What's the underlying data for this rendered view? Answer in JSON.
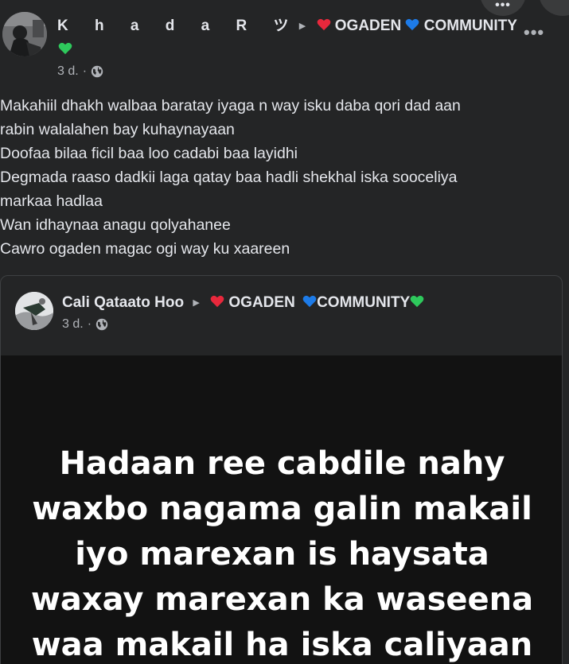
{
  "post": {
    "author": "K h a d a R ツ",
    "group": "OGADEN",
    "group_suffix": "COMMUNITY",
    "time": "3 d.",
    "separator": "·",
    "more": "•••",
    "lines": [
      "Makahiil dhakh walbaa baratay iyaga n way isku daba qori dad aan",
      "rabin walalahen bay kuhaynayaan",
      "Doofaa bilaa ficil baa loo cadabi baa layidhi",
      "Degmada raaso dadkii laga qatay baa hadli shekhal iska sooceliya",
      "markaa hadlaa",
      "Wan idhaynaa anagu qolyahanee",
      "Cawro ogaden magac ogi way ku xaareen"
    ]
  },
  "shared": {
    "author": "Cali Qataato Hoo",
    "group": "OGADEN",
    "group_suffix": "COMMUNITY",
    "time": "3 d.",
    "separator": "·",
    "image_lines": [
      "Hadaan ree cabdile nahy",
      "waxbo nagama galin makail",
      "iyo marexan is haysata",
      "waxay marexan ka waseena",
      "waa makail ha iska caliyaan"
    ]
  },
  "top_buttons": {
    "dots": "•••"
  },
  "icons": {
    "globe": "globe-icon",
    "arrow": "caret-right-icon",
    "heart_red": "red-heart-icon",
    "heart_blue": "blue-heart-icon",
    "heart_green": "green-heart-icon"
  },
  "colors": {
    "background": "#242526",
    "image_bg": "#121212",
    "text": "#e4e6eb",
    "secondary": "#b0b3b8",
    "heart_red": "#e8283c",
    "heart_blue": "#1d7be8",
    "heart_green": "#2ec95c"
  }
}
